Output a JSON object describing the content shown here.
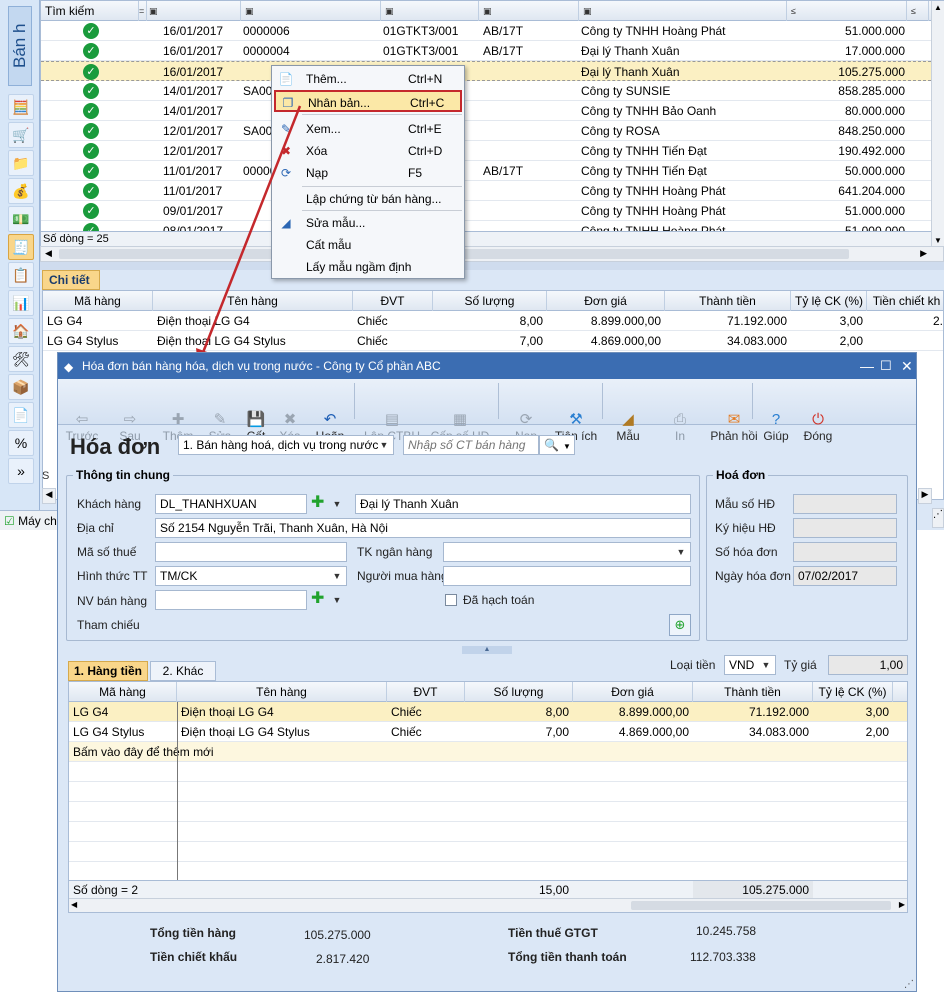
{
  "sidebar": {
    "title": "Bán h",
    "icons": [
      "calc-icon",
      "cart-icon",
      "folder-icon",
      "money-icon",
      "cash-icon",
      "invoice-icon",
      "notes-icon",
      "report-icon",
      "house-icon",
      "tools-icon",
      "box-icon",
      "document-icon",
      "percent-icon",
      "more-icon"
    ]
  },
  "main_grid": {
    "search_label": "Tìm kiếm",
    "filter_symbols": [
      "=",
      "▣",
      "▣",
      "▣",
      "▣",
      "▣",
      "≤",
      "≤"
    ],
    "rows": [
      {
        "date": "16/01/2017",
        "code": "0000006",
        "form": "01GTKT3/001",
        "serial": "AB/17T",
        "customer": "Công ty TNHH Hoàng Phát",
        "amount": "51.000.000"
      },
      {
        "date": "16/01/2017",
        "code": "0000004",
        "form": "01GTKT3/001",
        "serial": "AB/17T",
        "customer": "Đại lý Thanh Xuân",
        "amount": "17.000.000"
      },
      {
        "date": "16/01/2017",
        "code": "",
        "form": "",
        "serial": "",
        "customer": "Đại lý Thanh Xuân",
        "amount": "105.275.000"
      },
      {
        "date": "14/01/2017",
        "code": "SA00",
        "form": "",
        "serial": "",
        "customer": "Công ty SUNSIE",
        "amount": "858.285.000"
      },
      {
        "date": "14/01/2017",
        "code": "",
        "form": "",
        "serial": "",
        "customer": "Công ty TNHH Bảo Oanh",
        "amount": "80.000.000"
      },
      {
        "date": "12/01/2017",
        "code": "SA00",
        "form": "",
        "serial": "",
        "customer": "Công ty ROSA",
        "amount": "848.250.000"
      },
      {
        "date": "12/01/2017",
        "code": "",
        "form": "",
        "serial": "",
        "customer": "Công ty TNHH Tiến Đạt",
        "amount": "190.492.000"
      },
      {
        "date": "11/01/2017",
        "code": "00000",
        "form": "",
        "serial": "AB/17T",
        "customer": "Công ty TNHH Tiến Đạt",
        "amount": "50.000.000"
      },
      {
        "date": "11/01/2017",
        "code": "",
        "form": "",
        "serial": "",
        "customer": "Công ty TNHH Hoàng Phát",
        "amount": "641.204.000"
      },
      {
        "date": "09/01/2017",
        "code": "",
        "form": "",
        "serial": "",
        "customer": "Công ty TNHH Hoàng Phát",
        "amount": "51.000.000"
      },
      {
        "date": "08/01/2017",
        "code": "",
        "form": "",
        "serial": "",
        "customer": "Công ty TNHH Hoàng Phát",
        "amount": "51.000.000"
      }
    ],
    "row_count": "Số dòng = 25"
  },
  "detail": {
    "tab": "Chi tiết",
    "columns": [
      "Mã hàng",
      "Tên hàng",
      "ĐVT",
      "Số lượng",
      "Đơn giá",
      "Thành tiền",
      "Tỷ lệ CK (%)",
      "Tiền chiết kh"
    ],
    "rows": [
      {
        "code": "LG G4",
        "name": "Điện thoại LG G4",
        "unit": "Chiếc",
        "qty": "8,00",
        "price": "8.899.000,00",
        "total": "71.192.000",
        "ck": "3,00",
        "ckamt": "2."
      },
      {
        "code": "LG G4 Stylus",
        "name": "Điện thoại LG G4 Stylus",
        "unit": "Chiếc",
        "qty": "7,00",
        "price": "4.869.000,00",
        "total": "34.083.000",
        "ck": "2,00",
        "ckamt": ""
      }
    ],
    "side_letter": "S",
    "status": "Máy ch"
  },
  "context_menu": {
    "items": [
      {
        "label": "Thêm...",
        "shortcut": "Ctrl+N",
        "icon": "add-doc-icon"
      },
      {
        "label": "Nhân bản...",
        "shortcut": "Ctrl+C",
        "icon": "duplicate-icon"
      },
      {
        "label": "Xem...",
        "shortcut": "Ctrl+E",
        "icon": "edit-icon"
      },
      {
        "label": "Xóa",
        "shortcut": "Ctrl+D",
        "icon": "delete-icon"
      },
      {
        "label": "Nạp",
        "shortcut": "F5",
        "icon": "reload-icon"
      },
      {
        "label": "Lập chứng từ bán hàng...",
        "shortcut": "",
        "icon": ""
      },
      {
        "label": "Sửa mẫu...",
        "shortcut": "",
        "icon": "template-icon"
      },
      {
        "label": "Cất mẫu",
        "shortcut": "",
        "icon": ""
      },
      {
        "label": "Lấy mẫu ngầm định",
        "shortcut": "",
        "icon": ""
      }
    ]
  },
  "dialog": {
    "title": "Hóa đơn bán hàng hóa, dịch vụ trong nước - Công ty Cổ phần ABC",
    "toolbar": [
      {
        "label": "Trước",
        "icon": "back-icon",
        "glyph": "⇦",
        "enabled": false
      },
      {
        "label": "Sau",
        "icon": "forward-icon",
        "glyph": "⇨",
        "enabled": false
      },
      {
        "label": "Thêm",
        "icon": "add-icon",
        "glyph": "✚",
        "enabled": false
      },
      {
        "label": "Sửa",
        "icon": "edit-icon",
        "glyph": "✎",
        "enabled": false
      },
      {
        "label": "Cất",
        "icon": "save-icon",
        "glyph": "💾",
        "enabled": true
      },
      {
        "label": "Xóa",
        "icon": "delete-icon",
        "glyph": "✖",
        "enabled": false
      },
      {
        "label": "Hoãn",
        "icon": "undo-icon",
        "glyph": "↶",
        "enabled": true
      },
      {
        "label": "Lập CTBH",
        "icon": "create-voucher-icon",
        "glyph": "▤",
        "enabled": false
      },
      {
        "label": "Cấp số HĐ",
        "icon": "number-icon",
        "glyph": "▦",
        "enabled": false
      },
      {
        "label": "Nạp",
        "icon": "reload-icon",
        "glyph": "⟳",
        "enabled": false
      },
      {
        "label": "Tiện ích",
        "icon": "utility-icon",
        "glyph": "⚒",
        "enabled": true
      },
      {
        "label": "Mẫu",
        "icon": "template-icon",
        "glyph": "◢",
        "enabled": true
      },
      {
        "label": "In",
        "icon": "print-icon",
        "glyph": "⎙",
        "enabled": false
      },
      {
        "label": "Phản hồi",
        "icon": "feedback-icon",
        "glyph": "✉",
        "enabled": true
      },
      {
        "label": "Giúp",
        "icon": "help-icon",
        "glyph": "?",
        "enabled": true
      },
      {
        "label": "Đóng",
        "icon": "close-icon",
        "glyph": "⏻",
        "enabled": true
      }
    ],
    "heading": "Hóa đơn",
    "invoice_type": "1. Bán hàng hoá, dịch vụ trong nước",
    "search_placeholder": "Nhập số CT bán hàng",
    "general_title": "Thông tin chung",
    "labels": {
      "customer": "Khách hàng",
      "address": "Địa chỉ",
      "tax": "Mã số thuế",
      "bank": "TK ngân hàng",
      "payment": "Hình thức TT",
      "buyer": "Người mua hàng",
      "staff": "NV bán hàng",
      "posted": "Đã hạch toán",
      "ref": "Tham chiếu"
    },
    "values": {
      "customer_code": "DL_THANHXUAN",
      "customer_name": "Đại lý Thanh Xuân",
      "address": "Số 2154 Nguyễn Trãi, Thanh Xuân, Hà Nội",
      "tax": "",
      "bank": "",
      "payment": "TM/CK",
      "buyer": "",
      "staff": ""
    },
    "invoice_box": {
      "title": "Hoá đơn",
      "form": "Mẫu số HĐ",
      "serial": "Ký hiệu HĐ",
      "number": "Số hóa đơn",
      "date_label": "Ngày hóa đơn",
      "date": "07/02/2017"
    },
    "tabs": [
      "1. Hàng tiền",
      "2. Khác"
    ],
    "currency_label": "Loại tiền",
    "currency": "VND",
    "rate_label": "Tỷ giá",
    "rate": "1,00",
    "columns": [
      "Mã hàng",
      "Tên hàng",
      "ĐVT",
      "Số lượng",
      "Đơn giá",
      "Thành tiền",
      "Tỷ lệ CK (%)"
    ],
    "lines": [
      {
        "code": "LG G4",
        "name": "Điện thoại LG G4",
        "unit": "Chiếc",
        "qty": "8,00",
        "price": "8.899.000,00",
        "total": "71.192.000",
        "ck": "3,00"
      },
      {
        "code": "LG G4 Stylus",
        "name": "Điện thoại LG G4 Stylus",
        "unit": "Chiếc",
        "qty": "7,00",
        "price": "4.869.000,00",
        "total": "34.083.000",
        "ck": "2,00"
      }
    ],
    "add_row": "Bấm vào đây để thêm mới",
    "footer": {
      "count": "Số dòng = 2",
      "qty": "15,00",
      "total": "105.275.000"
    },
    "totals": {
      "goods_label": "Tổng tiền hàng",
      "goods": "105.275.000",
      "discount_label": "Tiền chiết khấu",
      "discount": "2.817.420",
      "vat_label": "Tiền thuế GTGT",
      "vat": "10.245.758",
      "pay_label": "Tổng tiền thanh toán",
      "pay": "112.703.338"
    }
  },
  "colors": {
    "highlight_row": "#fbf0c3",
    "menu_border": "#c4282c",
    "arrow": "#c4282c",
    "title_bar": "#3b6db2",
    "ok": "#1a9b3c"
  }
}
